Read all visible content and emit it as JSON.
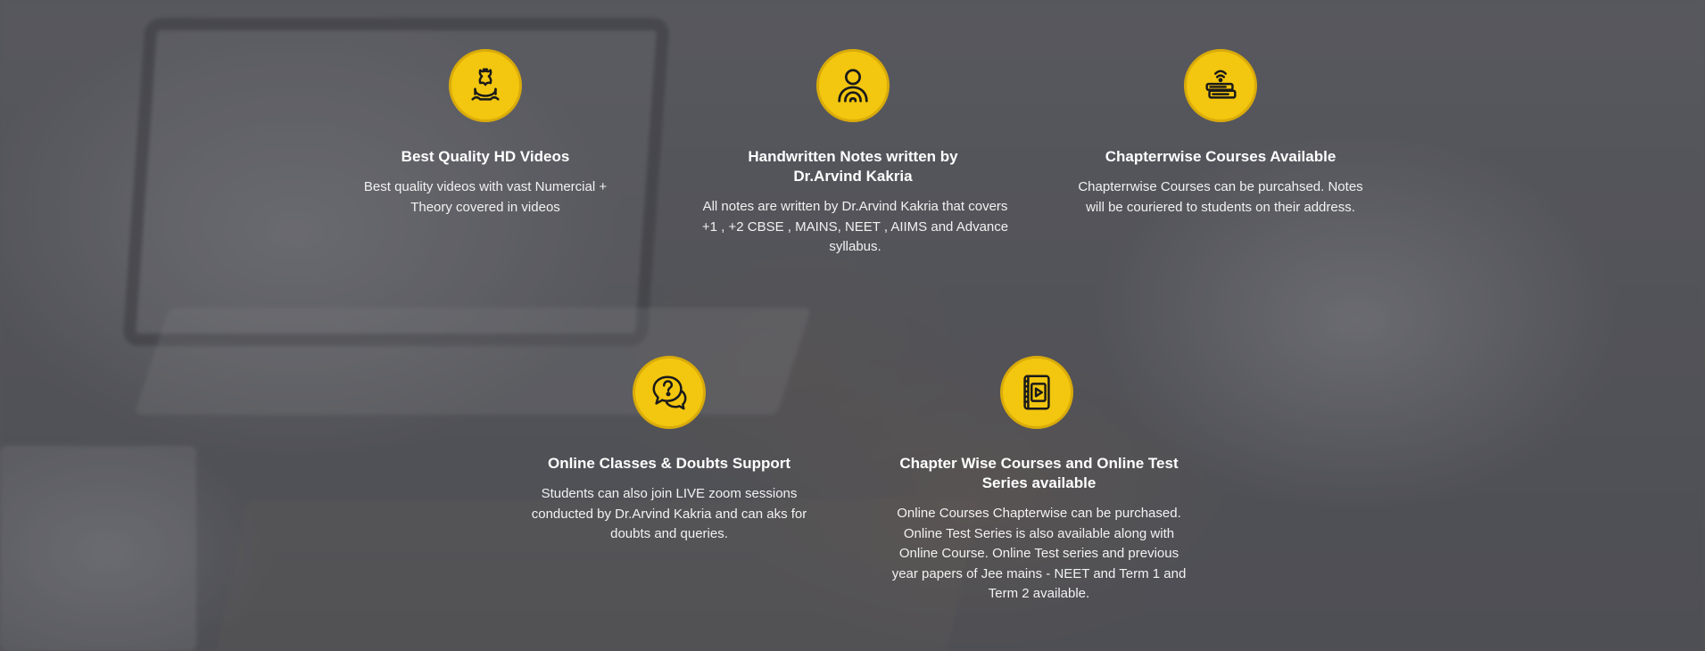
{
  "colors": {
    "accent": "#f3c60f",
    "icon_stroke": "#1a1a1a",
    "text": "#ffffff"
  },
  "features": [
    {
      "icon": "hd-video-icon",
      "title": "Best Quality HD Videos",
      "description": "Best quality videos with vast Numercial + Theory covered in videos"
    },
    {
      "icon": "person-notes-icon",
      "title": "Handwritten Notes written by Dr.Arvind Kakria",
      "description": "All notes are written by Dr.Arvind Kakria that covers +1 , +2 CBSE , MAINS, NEET , AIIMS and Advance syllabus."
    },
    {
      "icon": "courier-books-icon",
      "title": "Chapterrwise Courses Available",
      "description": "Chapterrwise  Courses can be purcahsed. Notes will be couriered to students on their address."
    },
    {
      "icon": "question-chat-icon",
      "title": "Online Classes & Doubts Support",
      "description": "Students can also join LIVE zoom sessions conducted by Dr.Arvind Kakria and can aks for doubts and queries."
    },
    {
      "icon": "video-book-icon",
      "title": "Chapter Wise Courses and Online Test Series available",
      "description": "Online Courses Chapterwise can be purchased. Online Test Series is also available along with Online Course.  Online Test series and previous year papers of Jee mains - NEET and Term 1 and Term 2 available."
    }
  ]
}
